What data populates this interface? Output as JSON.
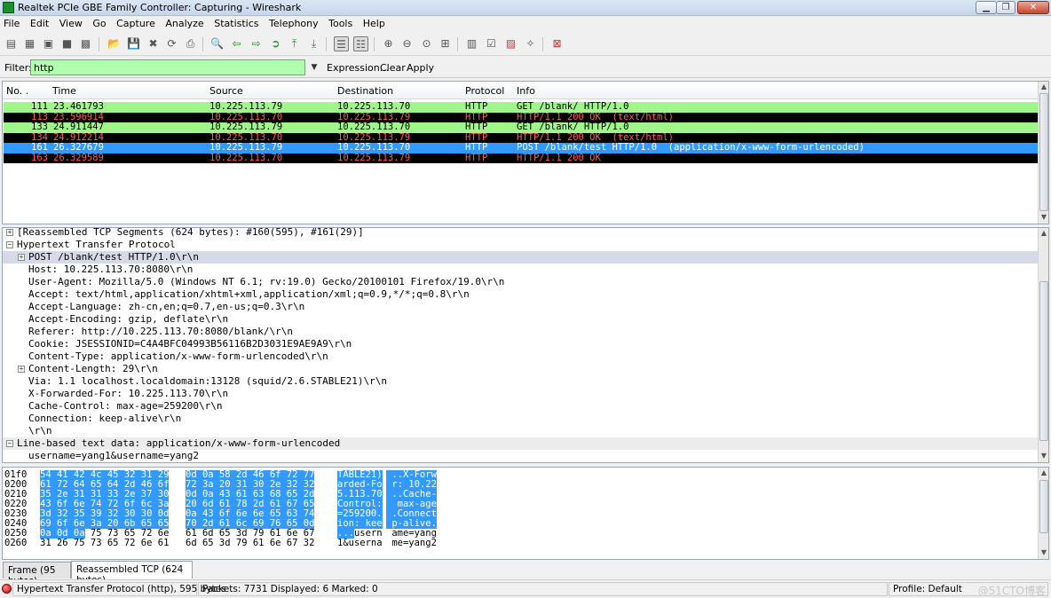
{
  "window": {
    "title": "Realtek PCIe GBE Family Controller: Capturing - Wireshark"
  },
  "menu": [
    "File",
    "Edit",
    "View",
    "Go",
    "Capture",
    "Analyze",
    "Statistics",
    "Telephony",
    "Tools",
    "Help"
  ],
  "filter": {
    "label": "Filter:",
    "value": "http",
    "expression": "Expression...",
    "clear": "Clear",
    "apply": "Apply"
  },
  "packet_list": {
    "columns": [
      "No. .",
      "Time",
      "Source",
      "Destination",
      "Protocol",
      "Info"
    ],
    "rows": [
      {
        "no": "111",
        "time": "23.461793",
        "src": "10.225.113.79",
        "dst": "10.225.113.70",
        "proto": "HTTP",
        "info": "GET /blank/ HTTP/1.0",
        "bg": "#a0f58b",
        "fg": "#000000"
      },
      {
        "no": "113",
        "time": "23.596914",
        "src": "10.225.113.70",
        "dst": "10.225.113.79",
        "proto": "HTTP",
        "info": "HTTP/1.1 200 OK  (text/html)",
        "bg": "#000000",
        "fg": "#ff5a5a"
      },
      {
        "no": "133",
        "time": "24.911447",
        "src": "10.225.113.79",
        "dst": "10.225.113.70",
        "proto": "HTTP",
        "info": "GET /blank/ HTTP/1.0",
        "bg": "#a0f58b",
        "fg": "#000000"
      },
      {
        "no": "134",
        "time": "24.912214",
        "src": "10.225.113.70",
        "dst": "10.225.113.79",
        "proto": "HTTP",
        "info": "HTTP/1.1 200 OK  (text/html)",
        "bg": "#000000",
        "fg": "#ff5a5a"
      },
      {
        "no": "161",
        "time": "26.327679",
        "src": "10.225.113.79",
        "dst": "10.225.113.70",
        "proto": "HTTP",
        "info": "POST /blank/test HTTP/1.0  (application/x-www-form-urlencoded)",
        "bg": "#3399ff",
        "fg": "#ffffff"
      },
      {
        "no": "163",
        "time": "26.329589",
        "src": "10.225.113.70",
        "dst": "10.225.113.79",
        "proto": "HTTP",
        "info": "HTTP/1.1 200 OK",
        "bg": "#000000",
        "fg": "#ff5a5a"
      }
    ]
  },
  "details": [
    {
      "level": 0,
      "expander": "+",
      "text": "[Reassembled TCP Segments (624 bytes): #160(595), #161(29)]"
    },
    {
      "level": 0,
      "expander": "-",
      "text": "Hypertext Transfer Protocol"
    },
    {
      "level": 1,
      "expander": "+",
      "text": "POST /blank/test HTTP/1.0\\r\\n",
      "highlight": true
    },
    {
      "level": 1,
      "expander": "",
      "text": "Host: 10.225.113.70:8080\\r\\n"
    },
    {
      "level": 1,
      "expander": "",
      "text": "User-Agent: Mozilla/5.0 (Windows NT 6.1; rv:19.0) Gecko/20100101 Firefox/19.0\\r\\n"
    },
    {
      "level": 1,
      "expander": "",
      "text": "Accept: text/html,application/xhtml+xml,application/xml;q=0.9,*/*;q=0.8\\r\\n"
    },
    {
      "level": 1,
      "expander": "",
      "text": "Accept-Language: zh-cn,en;q=0.7,en-us;q=0.3\\r\\n"
    },
    {
      "level": 1,
      "expander": "",
      "text": "Accept-Encoding: gzip, deflate\\r\\n"
    },
    {
      "level": 1,
      "expander": "",
      "text": "Referer: http://10.225.113.70:8080/blank/\\r\\n"
    },
    {
      "level": 1,
      "expander": "",
      "text": "Cookie: JSESSIONID=C4A4BFC04993B56116B2D3031E9AE9A9\\r\\n"
    },
    {
      "level": 1,
      "expander": "",
      "text": "Content-Type: application/x-www-form-urlencoded\\r\\n"
    },
    {
      "level": 1,
      "expander": "+",
      "text": "Content-Length: 29\\r\\n"
    },
    {
      "level": 1,
      "expander": "",
      "text": "Via: 1.1 localhost.localdomain:13128 (squid/2.6.STABLE21)\\r\\n"
    },
    {
      "level": 1,
      "expander": "",
      "text": "X-Forwarded-For: 10.225.113.70\\r\\n"
    },
    {
      "level": 1,
      "expander": "",
      "text": "Cache-Control: max-age=259200\\r\\n"
    },
    {
      "level": 1,
      "expander": "",
      "text": "Connection: keep-alive\\r\\n"
    },
    {
      "level": 1,
      "expander": "",
      "text": "\\r\\n"
    },
    {
      "level": 0,
      "expander": "-",
      "text": "Line-based text data: application/x-www-form-urlencoded",
      "section": true
    },
    {
      "level": 1,
      "expander": "",
      "text": "username=yang1&username=yang2"
    }
  ],
  "hex": [
    {
      "off": "01f0",
      "b1": "54 41 42 4c 45 32 31 29",
      "b2": "0d 0a 58 2d 46 6f 72 77",
      "a1": "TABLE21)",
      "a2": " ..X-Forw",
      "hl": "full"
    },
    {
      "off": "0200",
      "b1": "61 72 64 65 64 2d 46 6f",
      "b2": "72 3a 20 31 30 2e 32 32",
      "a1": "arded-Fo",
      "a2": " r: 10.22",
      "hl": "full"
    },
    {
      "off": "0210",
      "b1": "35 2e 31 31 33 2e 37 30",
      "b2": "0d 0a 43 61 63 68 65 2d",
      "a1": "5.113.70",
      "a2": " ..Cache-",
      "hl": "full"
    },
    {
      "off": "0220",
      "b1": "43 6f 6e 74 72 6f 6c 3a",
      "b2": "20 6d 61 78 2d 61 67 65",
      "a1": "Control:",
      "a2": "  max-age",
      "hl": "full"
    },
    {
      "off": "0230",
      "b1": "3d 32 35 39 32 30 30 0d",
      "b2": "0a 43 6f 6e 6e 65 63 74",
      "a1": "=259200.",
      "a2": " .Connect",
      "hl": "full"
    },
    {
      "off": "0240",
      "b1": "69 6f 6e 3a 20 6b 65 65",
      "b2": "70 2d 61 6c 69 76 65 0d",
      "a1": "ion: kee",
      "a2": " p-alive.",
      "hl": "full"
    },
    {
      "off": "0250",
      "b1": "0a 0d 0a 75 73 65 72 6e",
      "b2": "61 6d 65 3d 79 61 6e 67",
      "a1": "...usern",
      "a2": " ame=yang",
      "hl": "partial"
    },
    {
      "off": "0260",
      "b1": "31 26 75 73 65 72 6e 61",
      "b2": "6d 65 3d 79 61 6e 67 32",
      "a1": "1&userna",
      "a2": " me=yang2",
      "hl": "none"
    }
  ],
  "tabs": [
    "Frame (95 bytes)",
    "Reassembled TCP (624 bytes)"
  ],
  "status": {
    "left": "Hypertext Transfer Protocol (http), 595 bytes",
    "middle": "Packets: 7731 Displayed: 6 Marked: 0",
    "profile": "Profile: Default",
    "watermark": "@51CTO博客"
  }
}
